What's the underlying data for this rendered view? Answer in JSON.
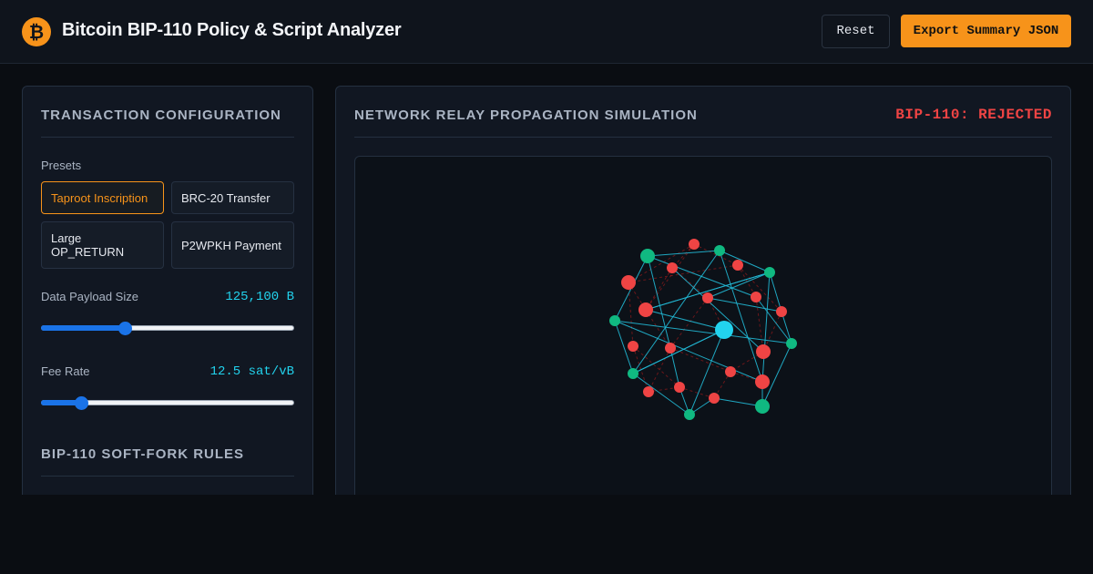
{
  "header": {
    "logo_glyph": "₿",
    "title": "Bitcoin BIP-110 Policy & Script Analyzer",
    "reset_label": "Reset",
    "export_label": "Export Summary JSON"
  },
  "config": {
    "title": "TRANSACTION CONFIGURATION",
    "presets_label": "Presets",
    "presets": [
      {
        "label": "Taproot Inscription",
        "active": true
      },
      {
        "label": "BRC-20 Transfer",
        "active": false
      },
      {
        "label": "Large OP_RETURN",
        "active": false
      },
      {
        "label": "P2WPKH Payment",
        "active": false
      }
    ],
    "payload": {
      "label": "Data Payload Size",
      "value": "125,100 B",
      "slider_fraction": 0.33
    },
    "fee": {
      "label": "Fee Rate",
      "value": "12.5 sat/vB",
      "slider_fraction": 0.16
    },
    "rules_title": "BIP-110 SOFT-FORK RULES"
  },
  "simulation": {
    "title": "NETWORK RELAY PROPAGATION SIMULATION",
    "status": "BIP-110: REJECTED",
    "colors": {
      "rejecting_node": "#ef4444",
      "relaying_node": "#10b981",
      "origin_node": "#22d3ee",
      "relay_edge": "#22b8d4",
      "blocked_edge": "#b91c1c"
    }
  }
}
